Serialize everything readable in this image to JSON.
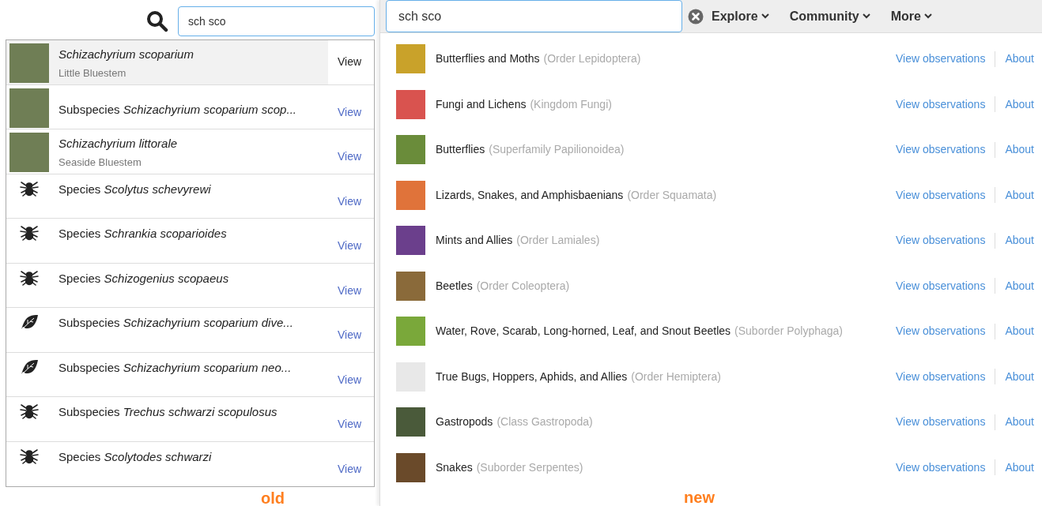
{
  "old": {
    "search": {
      "value": "sch sco"
    },
    "results": [
      {
        "name": "Schizachyrium scoparium",
        "common": "Little Bluestem",
        "kind": "photo",
        "selected": true,
        "action": "View"
      },
      {
        "rank": "Subspecies",
        "name": "Schizachyrium scoparium scop...",
        "kind": "photo",
        "selected": false,
        "action": "View"
      },
      {
        "name": "Schizachyrium littorale",
        "common": "Seaside Bluestem",
        "kind": "photo",
        "selected": false,
        "action": "View"
      },
      {
        "rank": "Species",
        "name": "Scolytus schevyrewi",
        "kind": "bug",
        "selected": false,
        "action": "View"
      },
      {
        "rank": "Species",
        "name": "Schrankia scoparioides",
        "kind": "bug",
        "selected": false,
        "action": "View"
      },
      {
        "rank": "Species",
        "name": "Schizogenius scopaeus",
        "kind": "bug",
        "selected": false,
        "action": "View"
      },
      {
        "rank": "Subspecies",
        "name": "Schizachyrium scoparium dive...",
        "kind": "leaf",
        "selected": false,
        "action": "View"
      },
      {
        "rank": "Subspecies",
        "name": "Schizachyrium scoparium neo...",
        "kind": "leaf",
        "selected": false,
        "action": "View"
      },
      {
        "rank": "Subspecies",
        "name": "Trechus schwarzi scopulosus",
        "kind": "bug",
        "selected": false,
        "action": "View"
      },
      {
        "rank": "Species",
        "name": "Scolytodes schwarzi",
        "kind": "bug",
        "selected": false,
        "action": "View"
      }
    ],
    "caption": "old"
  },
  "new": {
    "search": {
      "value": "sch sco"
    },
    "nav": [
      "Explore",
      "Community",
      "More"
    ],
    "results": [
      {
        "name": "Butterflies and Moths",
        "taxon": "(Order Lepidoptera)",
        "color": "#c9a22a",
        "links": [
          "View observations",
          "About"
        ]
      },
      {
        "name": "Fungi and Lichens",
        "taxon": "(Kingdom Fungi)",
        "color": "#d9534f",
        "links": [
          "View observations",
          "About"
        ]
      },
      {
        "name": "Butterflies",
        "taxon": "(Superfamily Papilionoidea)",
        "color": "#6a8c3a",
        "links": [
          "View observations",
          "About"
        ]
      },
      {
        "name": "Lizards, Snakes, and Amphisbaenians",
        "taxon": "(Order Squamata)",
        "color": "#e0733a",
        "links": [
          "View observations",
          "About"
        ]
      },
      {
        "name": "Mints and Allies",
        "taxon": "(Order Lamiales)",
        "color": "#6b3f8c",
        "links": [
          "View observations",
          "About"
        ]
      },
      {
        "name": "Beetles",
        "taxon": "(Order Coleoptera)",
        "color": "#8a6a3a",
        "links": [
          "View observations",
          "About"
        ]
      },
      {
        "name": "Water, Rove, Scarab, Long-horned, Leaf, and Snout Beetles",
        "taxon": "(Suborder Polyphaga)",
        "color": "#7aa83a",
        "links": [
          "View observations",
          "About"
        ]
      },
      {
        "name": "True Bugs, Hoppers, Aphids, and Allies",
        "taxon": "(Order Hemiptera)",
        "color": "#e8e8e8",
        "links": [
          "View observations",
          "About"
        ]
      },
      {
        "name": "Gastropods",
        "taxon": "(Class Gastropoda)",
        "color": "#4a5a3a",
        "links": [
          "View observations",
          "About"
        ]
      },
      {
        "name": "Snakes",
        "taxon": "(Suborder Serpentes)",
        "color": "#6a4a2a",
        "links": [
          "View observations",
          "About"
        ]
      }
    ],
    "caption": "new"
  }
}
